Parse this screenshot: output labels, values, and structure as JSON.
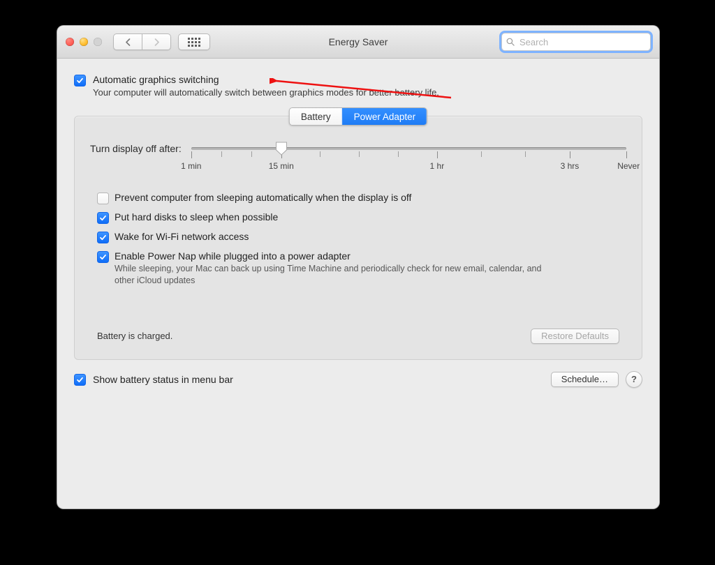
{
  "window": {
    "title": "Energy Saver"
  },
  "search": {
    "placeholder": "Search",
    "value": ""
  },
  "auto_gfx": {
    "label": "Automatic graphics switching",
    "desc": "Your computer will automatically switch between graphics modes for better battery life.",
    "checked": true
  },
  "tabs": {
    "battery": "Battery",
    "adapter": "Power Adapter",
    "selected": "adapter"
  },
  "slider": {
    "label": "Turn display off after:",
    "ticks": [
      "1 min",
      "15 min",
      "1 hr",
      "3 hrs",
      "Never"
    ],
    "tick_positions_pct": [
      0,
      20.7,
      56.5,
      87,
      100
    ],
    "value_pct": 20.7
  },
  "options": [
    {
      "label": "Prevent computer from sleeping automatically when the display is off",
      "checked": false
    },
    {
      "label": "Put hard disks to sleep when possible",
      "checked": true
    },
    {
      "label": "Wake for Wi-Fi network access",
      "checked": true
    },
    {
      "label": "Enable Power Nap while plugged into a power adapter",
      "checked": true,
      "sub": "While sleeping, your Mac can back up using Time Machine and periodically check for new email, calendar, and other iCloud updates"
    }
  ],
  "status_text": "Battery is charged.",
  "buttons": {
    "restore": "Restore Defaults",
    "schedule": "Schedule…"
  },
  "show_menu_bar": {
    "label": "Show battery status in menu bar",
    "checked": true
  },
  "help_glyph": "?"
}
